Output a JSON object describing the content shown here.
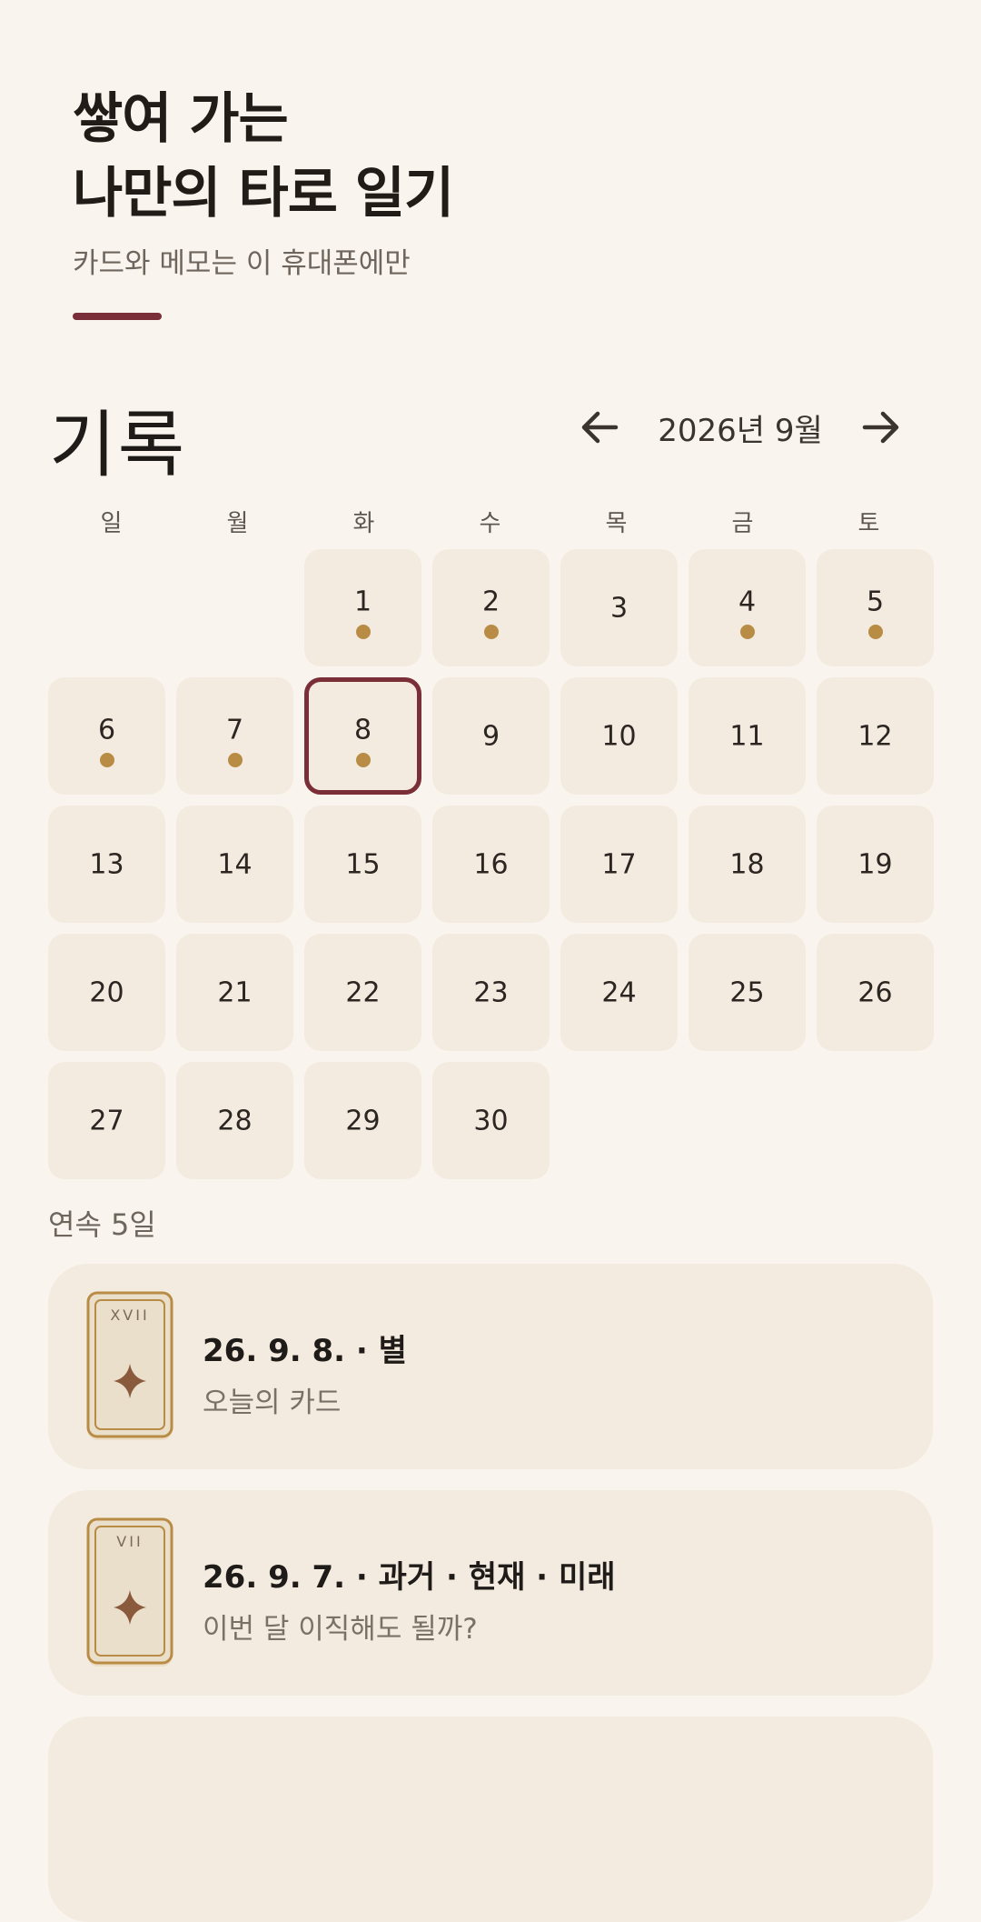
{
  "header": {
    "title_line1": "쌓여 가는",
    "title_line2": "나만의 타로 일기",
    "subtitle": "카드와 메모는 이 휴대폰에만"
  },
  "calendar": {
    "section_title": "기록",
    "month_label": "2026년 9월",
    "weekdays": [
      "일",
      "월",
      "화",
      "수",
      "목",
      "금",
      "토"
    ],
    "leading_blanks": 2,
    "days": [
      {
        "day": "1",
        "has_entry": true
      },
      {
        "day": "2",
        "has_entry": true
      },
      {
        "day": "3",
        "has_entry": false
      },
      {
        "day": "4",
        "has_entry": true
      },
      {
        "day": "5",
        "has_entry": true
      },
      {
        "day": "6",
        "has_entry": true
      },
      {
        "day": "7",
        "has_entry": true
      },
      {
        "day": "8",
        "has_entry": true,
        "selected": true
      },
      {
        "day": "9",
        "has_entry": false
      },
      {
        "day": "10",
        "has_entry": false
      },
      {
        "day": "11",
        "has_entry": false
      },
      {
        "day": "12",
        "has_entry": false
      },
      {
        "day": "13",
        "has_entry": false
      },
      {
        "day": "14",
        "has_entry": false
      },
      {
        "day": "15",
        "has_entry": false
      },
      {
        "day": "16",
        "has_entry": false
      },
      {
        "day": "17",
        "has_entry": false
      },
      {
        "day": "18",
        "has_entry": false
      },
      {
        "day": "19",
        "has_entry": false
      },
      {
        "day": "20",
        "has_entry": false
      },
      {
        "day": "21",
        "has_entry": false
      },
      {
        "day": "22",
        "has_entry": false
      },
      {
        "day": "23",
        "has_entry": false
      },
      {
        "day": "24",
        "has_entry": false
      },
      {
        "day": "25",
        "has_entry": false
      },
      {
        "day": "26",
        "has_entry": false
      },
      {
        "day": "27",
        "has_entry": false
      },
      {
        "day": "28",
        "has_entry": false
      },
      {
        "day": "29",
        "has_entry": false
      },
      {
        "day": "30",
        "has_entry": false
      }
    ]
  },
  "streak": "연속 5일",
  "entries": [
    {
      "numeral": "XVII",
      "title": "26. 9. 8. · 별",
      "memo": "오늘의 카드"
    },
    {
      "numeral": "VII",
      "title": "26. 9. 7. · 과거 · 현재 · 미래",
      "memo": "이번 달 이직해도 될까?"
    }
  ],
  "colors": {
    "background": "#f9f5ee",
    "cell": "#f3ebdf",
    "accent": "#7a2e38",
    "dot": "#b98c45"
  },
  "icons": {
    "prev": "arrow-left-icon",
    "next": "arrow-right-icon",
    "card_star": "four-point-star-icon"
  }
}
